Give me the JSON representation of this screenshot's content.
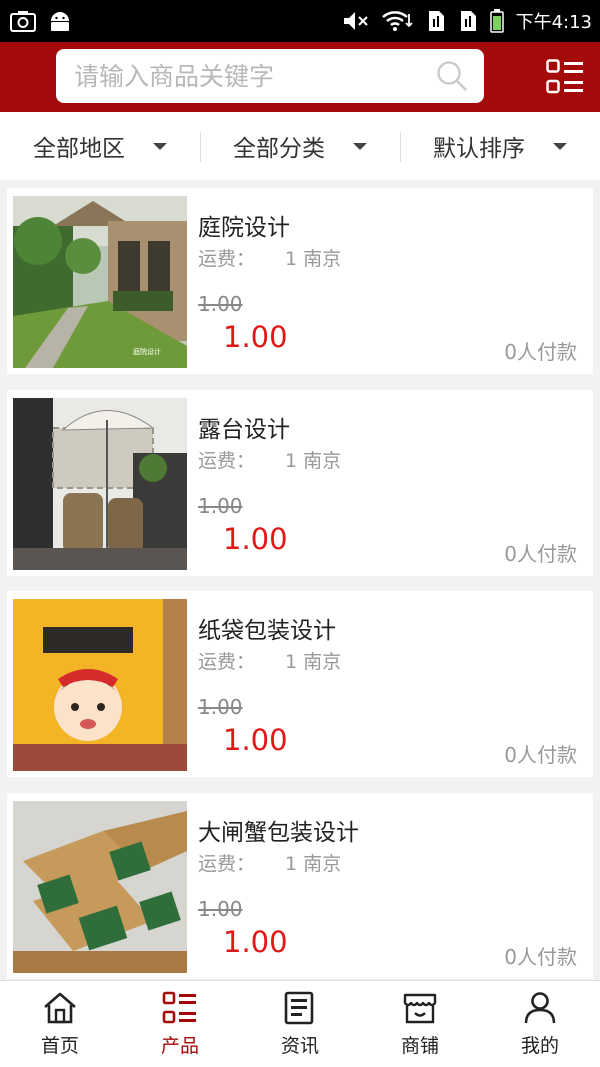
{
  "status_bar": {
    "time": "下午4:13"
  },
  "search": {
    "placeholder": "请输入商品关键字"
  },
  "filters": [
    {
      "label": "全部地区"
    },
    {
      "label": "全部分类"
    },
    {
      "label": "默认排序"
    }
  ],
  "products": [
    {
      "name": "庭院设计",
      "freight_label": "运费：",
      "freight_value": "1 南京",
      "old_price": "1.00",
      "price": "1.00",
      "paid": "0人付款"
    },
    {
      "name": "露台设计",
      "freight_label": "运费：",
      "freight_value": "1 南京",
      "old_price": "1.00",
      "price": "1.00",
      "paid": "0人付款"
    },
    {
      "name": "纸袋包装设计",
      "freight_label": "运费：",
      "freight_value": "1 南京",
      "old_price": "1.00",
      "price": "1.00",
      "paid": "0人付款"
    },
    {
      "name": "大闸蟹包装设计",
      "freight_label": "运费：",
      "freight_value": "1 南京",
      "old_price": "1.00",
      "price": "1.00",
      "paid": "0人付款"
    }
  ],
  "tabs": [
    {
      "label": "首页",
      "icon": "home-icon",
      "active": false
    },
    {
      "label": "产品",
      "icon": "product-list-icon",
      "active": true
    },
    {
      "label": "资讯",
      "icon": "news-icon",
      "active": false
    },
    {
      "label": "商铺",
      "icon": "store-icon",
      "active": false
    },
    {
      "label": "我的",
      "icon": "user-icon",
      "active": false
    }
  ],
  "colors": {
    "brand": "#a40a0a",
    "price": "#e21818"
  }
}
